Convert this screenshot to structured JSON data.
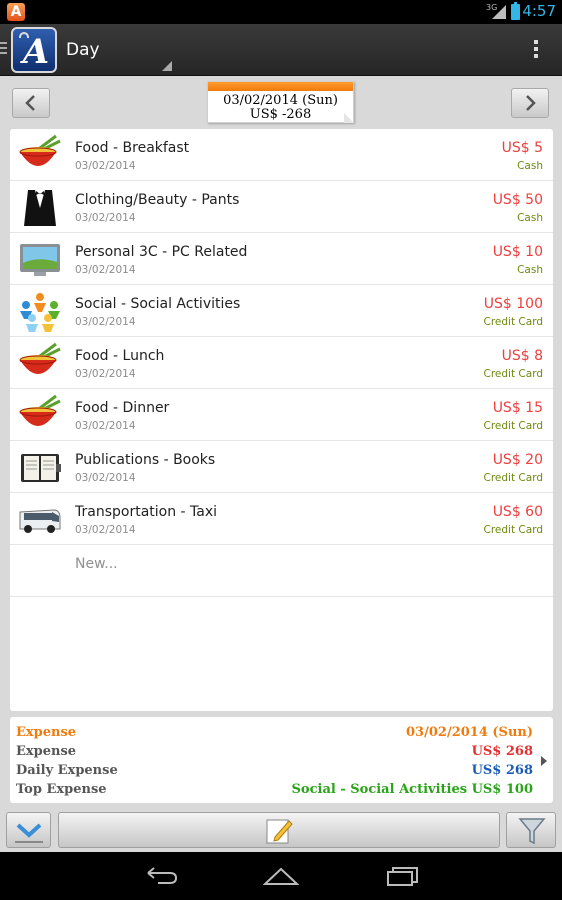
{
  "status_bar": {
    "app_badge": "A",
    "network": "3G",
    "time": "4:57"
  },
  "action_bar": {
    "title": "Day"
  },
  "date_header": {
    "date": "03/02/2014 (Sun)",
    "total": "US$ -268"
  },
  "entries": [
    {
      "category": "Food - Breakfast",
      "date": "03/02/2014",
      "amount": "US$ 5",
      "account": "Cash",
      "icon": "noodle-bowl-icon"
    },
    {
      "category": "Clothing/Beauty - Pants",
      "date": "03/02/2014",
      "amount": "US$ 50",
      "account": "Cash",
      "icon": "tuxedo-icon"
    },
    {
      "category": "Personal 3C - PC Related",
      "date": "03/02/2014",
      "amount": "US$ 10",
      "account": "Cash",
      "icon": "monitor-icon"
    },
    {
      "category": "Social - Social Activities",
      "date": "03/02/2014",
      "amount": "US$ 100",
      "account": "Credit Card",
      "icon": "people-circle-icon"
    },
    {
      "category": "Food - Lunch",
      "date": "03/02/2014",
      "amount": "US$ 8",
      "account": "Credit Card",
      "icon": "noodle-bowl-icon"
    },
    {
      "category": "Food - Dinner",
      "date": "03/02/2014",
      "amount": "US$ 15",
      "account": "Credit Card",
      "icon": "noodle-bowl-icon"
    },
    {
      "category": "Publications - Books",
      "date": "03/02/2014",
      "amount": "US$ 20",
      "account": "Credit Card",
      "icon": "notebook-icon"
    },
    {
      "category": "Transportation - Taxi",
      "date": "03/02/2014",
      "amount": "US$ 60",
      "account": "Credit Card",
      "icon": "bus-icon"
    }
  ],
  "new_entry_label": "New...",
  "summary": {
    "header_label": "Expense",
    "header_value": "03/02/2014 (Sun)",
    "rows": [
      {
        "label": "Expense",
        "value": "US$ 268"
      },
      {
        "label": "Daily Expense",
        "value": "US$ 268"
      },
      {
        "label": "Top Expense",
        "value": "Social - Social Activities US$ 100"
      }
    ]
  },
  "colors": {
    "amount": "#ee3f3f",
    "account": "#6d8a10",
    "summary_orange": "#f07a0c",
    "summary_red": "#e43030",
    "summary_blue": "#1a5bb5",
    "summary_green": "#2aa31a"
  }
}
